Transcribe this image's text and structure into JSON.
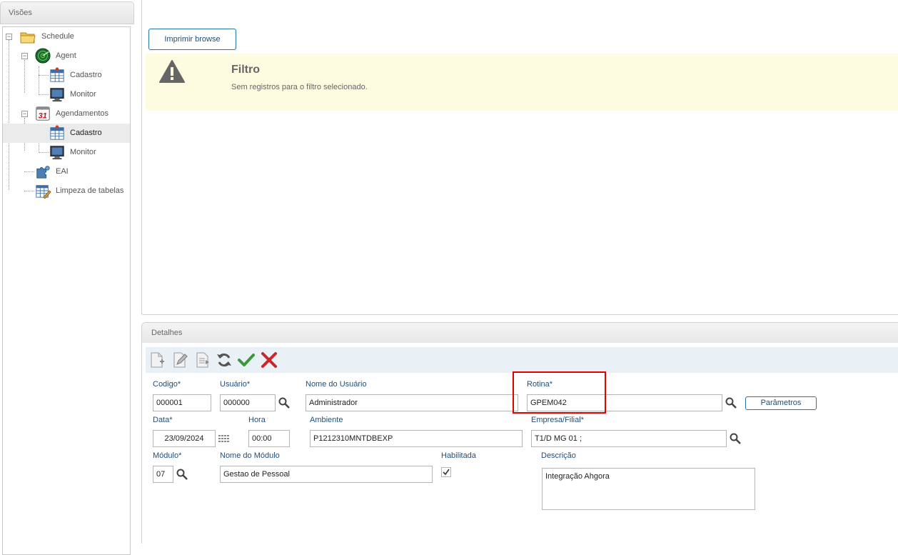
{
  "sidebar": {
    "header": "Visões",
    "tree": {
      "schedule": "Schedule",
      "agent": "Agent",
      "agent_cadastro": "Cadastro",
      "agent_monitor": "Monitor",
      "agendamentos": "Agendamentos",
      "agendamentos_cadastro": "Cadastro",
      "agendamentos_monitor": "Monitor",
      "eai": "EAI",
      "limpeza": "Limpeza de tabelas",
      "selected": "Agendamentos / Cadastro",
      "calendar_icon_text": "31"
    }
  },
  "browse": {
    "print_button": "Imprimir browse",
    "filter_title": "Filtro",
    "filter_message": "Sem registros para o filtro selecionado."
  },
  "details": {
    "header": "Detalhes",
    "toolbar": [
      "new-icon",
      "edit-icon",
      "copy-icon",
      "refresh-icon",
      "confirm-icon",
      "cancel-icon"
    ],
    "labels": {
      "codigo": "Codigo*",
      "usuario": "Usuário*",
      "nome_usuario": "Nome do Usuário",
      "rotina": "Rotina*",
      "data": "Data*",
      "hora": "Hora",
      "ambiente": "Ambiente",
      "empresa": "Empresa/Filial*",
      "modulo": "Módulo*",
      "nome_modulo": "Nome do Módulo",
      "habilitada": "Habilitada",
      "descricao": "Descrição"
    },
    "values": {
      "codigo": "000001",
      "usuario": "000000",
      "nome_usuario": "Administrador",
      "rotina": "GPEM042",
      "data": "23/09/2024",
      "hora": "00:00",
      "ambiente": "P1212310MNTDBEXP",
      "empresa": "T1/D MG 01 ;",
      "modulo": "07",
      "nome_modulo": "Gestao de Pessoal",
      "habilitada": true,
      "descricao": "Integração Ahgora"
    },
    "parametros_button": "Parâmetros",
    "highlight_color": "#e00000"
  }
}
